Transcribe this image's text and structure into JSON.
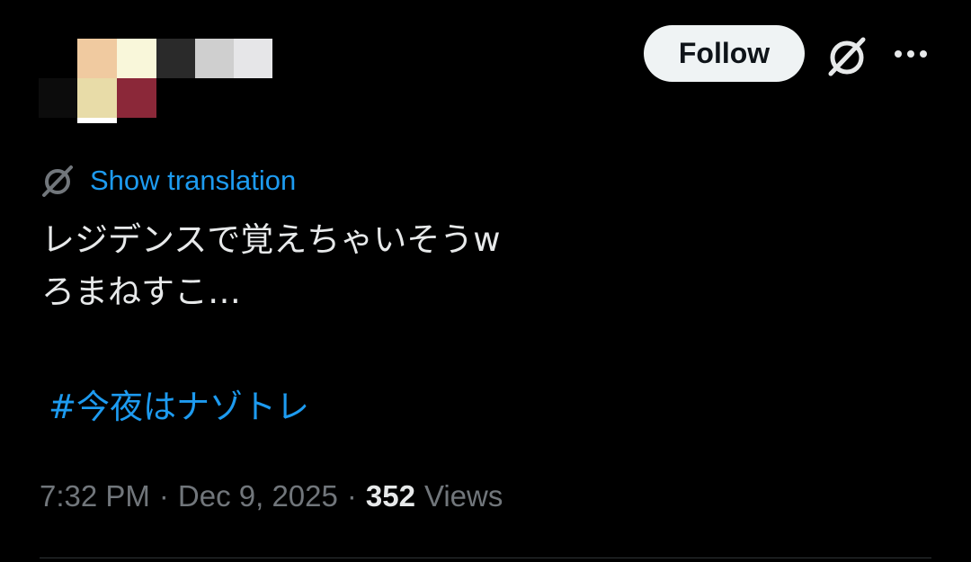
{
  "header": {
    "follow_label": "Follow",
    "grok_icon": "grok-icon",
    "more_icon": "more-horizontal-icon",
    "avatar_note": "pixelated-avatar"
  },
  "translation": {
    "icon": "globe-icon",
    "label": "Show translation"
  },
  "tweet": {
    "lines": [
      "レジデンスで覚えちゃいそうw",
      "ろまねすこ…"
    ],
    "hashtag": "#今夜はナゾトレ"
  },
  "meta": {
    "time": "7:32 PM",
    "separator": "·",
    "date": "Dec 9, 2025",
    "views_count": "352",
    "views_label": "Views"
  },
  "colors": {
    "background": "#000000",
    "text_primary": "#e7e9ea",
    "text_secondary": "#71767b",
    "accent": "#1d9bf0",
    "follow_bg": "#eff3f4",
    "avatar_pixels": [
      "#f0caa0",
      "#f9f7da",
      "#2a2a2a",
      "#cfcfcf",
      "#e6e6e8",
      "#0c0c0c",
      "#e8dca8",
      "#8b2839",
      "#ffffff"
    ]
  }
}
